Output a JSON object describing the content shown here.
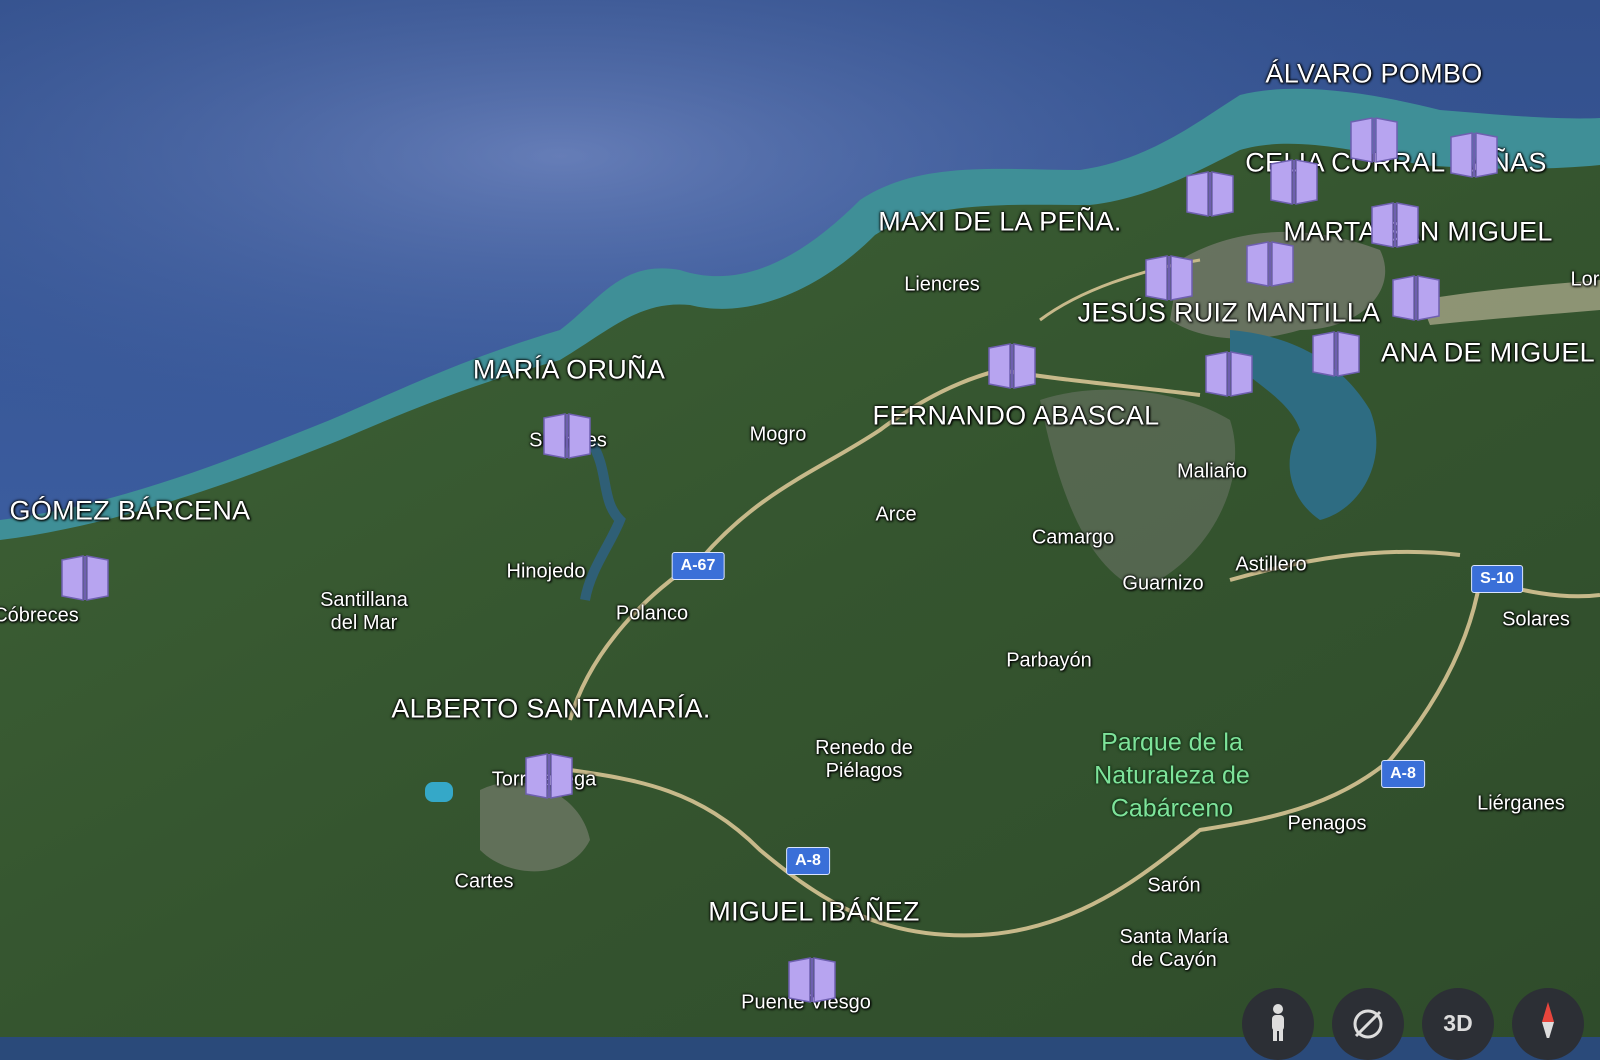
{
  "authors": [
    {
      "id": "alvaro-pombo",
      "text": "ÁLVARO POMBO"
    },
    {
      "id": "celia-corral-canas",
      "text": "CELIA CORRAL CAÑAS"
    },
    {
      "id": "maxi-de-la-pena",
      "text": "MAXI DE LA PEÑA."
    },
    {
      "id": "marta-san-miguel",
      "text": "MARTA SAN MIGUEL"
    },
    {
      "id": "jesus-ruiz-mantilla",
      "text": "JESÚS RUIZ MANTILLA"
    },
    {
      "id": "ana-de-miguel",
      "text": "ANA DE MIGUEL"
    },
    {
      "id": "maria-oruna",
      "text": "MARÍA ORUÑA"
    },
    {
      "id": "fernando-abascal",
      "text": "FERNANDO ABASCAL"
    },
    {
      "id": "gomez-barcena",
      "text": "GÓMEZ BÁRCENA"
    },
    {
      "id": "alberto-santamaria",
      "text": "ALBERTO SANTAMARÍA."
    },
    {
      "id": "miguel-ibanez",
      "text": "MIGUEL IBÁÑEZ"
    }
  ],
  "towns": [
    {
      "id": "liencres",
      "text": "Liencres"
    },
    {
      "id": "mogro",
      "text": "Mogro"
    },
    {
      "id": "suances",
      "text": "Suances"
    },
    {
      "id": "maliano",
      "text": "Maliaño"
    },
    {
      "id": "arce",
      "text": "Arce"
    },
    {
      "id": "camargo",
      "text": "Camargo"
    },
    {
      "id": "hinojedo",
      "text": "Hinojedo"
    },
    {
      "id": "astillero",
      "text": "Astillero"
    },
    {
      "id": "guarnizo",
      "text": "Guarnizo"
    },
    {
      "id": "cobreces",
      "text": "Cóbreces"
    },
    {
      "id": "santillana",
      "text": "Santillana\ndel Mar"
    },
    {
      "id": "polanco",
      "text": "Polanco"
    },
    {
      "id": "solares",
      "text": "Solares"
    },
    {
      "id": "parbayon",
      "text": "Parbayón"
    },
    {
      "id": "renedo",
      "text": "Renedo de\nPiélagos"
    },
    {
      "id": "torrelavega",
      "text": "Torrelavega"
    },
    {
      "id": "penagos",
      "text": "Penagos"
    },
    {
      "id": "lierganes",
      "text": "Liérganes"
    },
    {
      "id": "cartes",
      "text": "Cartes"
    },
    {
      "id": "saron",
      "text": "Sarón"
    },
    {
      "id": "santa-maria-de-cayon",
      "text": "Santa María\nde Cayón"
    },
    {
      "id": "puente-viesgo",
      "text": "Puente Viesgo"
    },
    {
      "id": "loredo",
      "text": "Lor"
    }
  ],
  "park": {
    "text": "Parque de la\nNaturaleza de\nCabárceno",
    "color": "#7ee39a"
  },
  "roads": [
    {
      "id": "a67",
      "text": "A-67"
    },
    {
      "id": "s10",
      "text": "S-10"
    },
    {
      "id": "a8-east",
      "text": "A-8"
    },
    {
      "id": "a8-south",
      "text": "A-8"
    }
  ],
  "controls": {
    "three_d_label": "3D"
  },
  "colors": {
    "sea_deep": "#2c4a86",
    "sea_mid": "#3d63a8",
    "coast": "#4fa7a8",
    "land": "#3a5a32",
    "marker": "#b7a4f0",
    "road_badge": "#3a6fd8"
  },
  "marker_icon": "open-book-icon",
  "marker_count": 20
}
